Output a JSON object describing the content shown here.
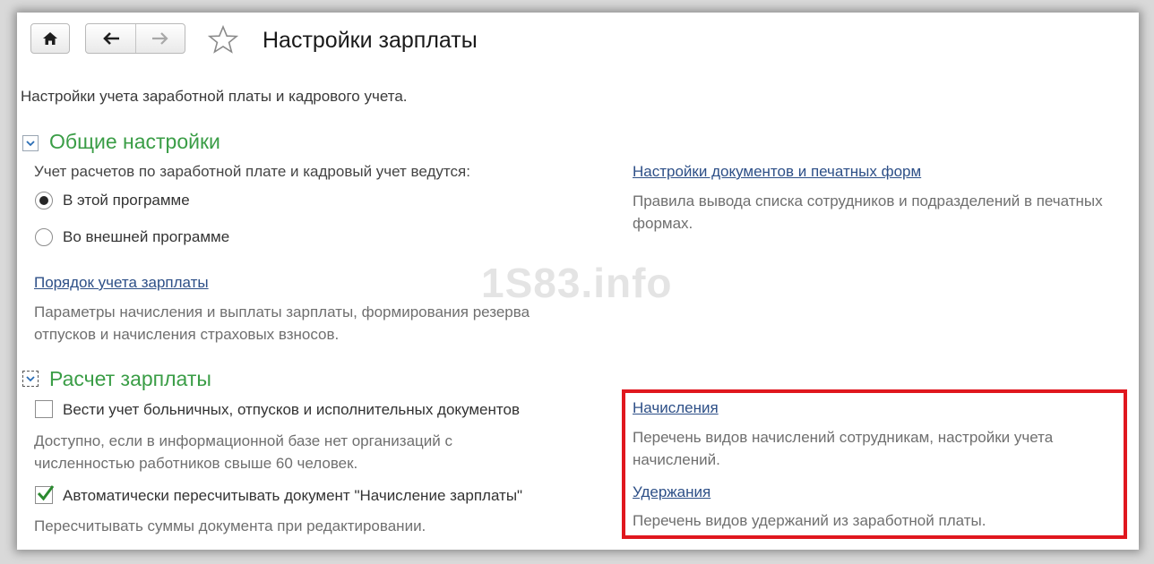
{
  "window": {
    "title": "Настройки зарплаты"
  },
  "subtitle": "Настройки учета заработной платы и кадрового учета.",
  "watermark": "1S83.info",
  "general": {
    "header": "Общие настройки",
    "accounting_label": "Учет расчетов по заработной плате и кадровый учет ведутся:",
    "radio_this_program": "В этой программе",
    "radio_external_program": "Во внешней программе",
    "selected": "this_program",
    "order_link": "Порядок учета зарплаты",
    "order_hint": "Параметры начисления и выплаты зарплаты, формирования резерва отпусков и начисления страховых взносов.",
    "docs_link": "Настройки документов и печатных форм",
    "docs_hint": "Правила вывода списка сотрудников и подразделений в печатных формах."
  },
  "payroll": {
    "header": "Расчет зарплаты",
    "sick_checkbox": "Вести учет больничных, отпусков и исполнительных документов",
    "sick_checked": false,
    "sick_hint": "Доступно, если в информационной базе нет организаций с численностью работников свыше 60 человек.",
    "recalc_checkbox": "Автоматически пересчитывать документ \"Начисление зарплаты\"",
    "recalc_checked": true,
    "recalc_hint": "Пересчитывать суммы документа при редактировании.",
    "accruals_link": "Начисления",
    "accruals_hint": "Перечень видов начислений сотрудникам, настройки учета начислений.",
    "deductions_link": "Удержания",
    "deductions_hint": "Перечень видов удержаний из заработной платы."
  },
  "colors": {
    "section_header": "#3a9d46",
    "link": "#2d4f87",
    "highlight": "#e0171e"
  },
  "icons": {
    "home": "home-icon",
    "back": "arrow-left-icon",
    "forward": "arrow-right-icon",
    "favorite": "star-icon",
    "collapse": "chevron-down-icon",
    "check": "checkmark-icon"
  }
}
